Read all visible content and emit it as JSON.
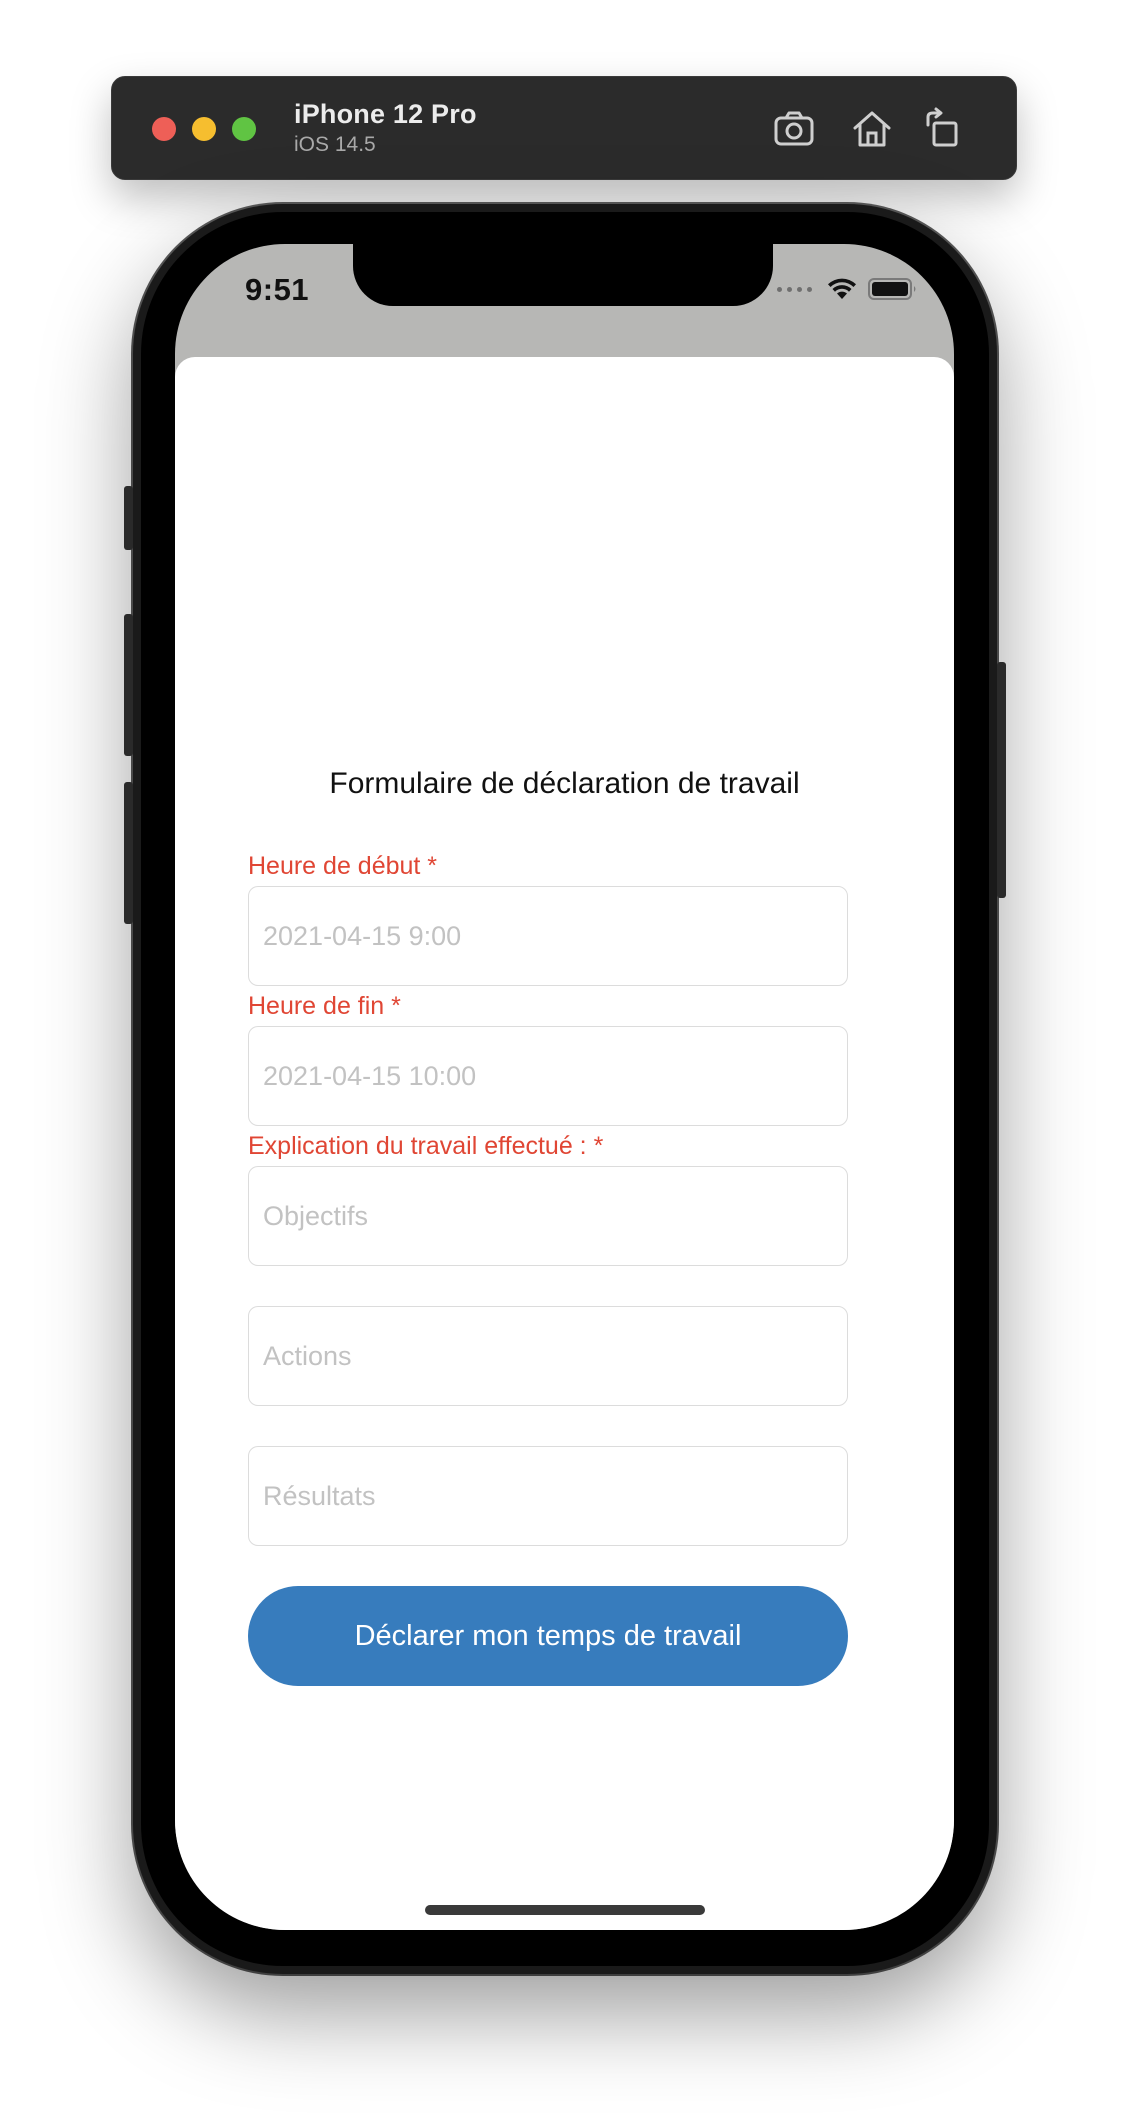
{
  "simulator": {
    "device_name": "iPhone 12 Pro",
    "os_version": "iOS 14.5",
    "buttons": [
      "camera-icon",
      "home-icon",
      "rotate-icon"
    ]
  },
  "status_bar": {
    "time": "9:51",
    "icons": [
      "cellular-signal-icon",
      "wifi-icon",
      "battery-icon"
    ]
  },
  "form": {
    "title": "Formulaire de déclaration de travail",
    "start": {
      "label": "Heure de début *",
      "placeholder": "2021-04-15 9:00",
      "value": ""
    },
    "end": {
      "label": "Heure de fin *",
      "placeholder": "2021-04-15 10:00",
      "value": ""
    },
    "explanation": {
      "label": "Explication du travail effectué : *",
      "objectives_placeholder": "Objectifs",
      "actions_placeholder": "Actions",
      "results_placeholder": "Résultats"
    },
    "submit_label": "Déclarer mon temps de travail"
  },
  "colors": {
    "accent": "#377cbd",
    "required_label": "#e04634",
    "placeholder": "#c2c2c2",
    "status_bar_background": "#b7b7b5"
  }
}
